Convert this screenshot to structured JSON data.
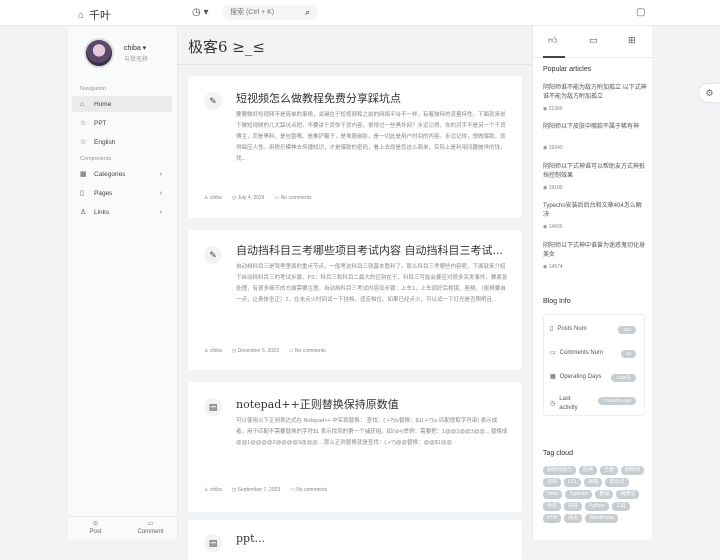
{
  "header": {
    "logo_text": "千叶",
    "search_placeholder": "搜索 (Ctrl + K)"
  },
  "sidebar": {
    "user_name": "chiba",
    "user_sub": "与世无枠",
    "nav_title": "Navigation",
    "components_title": "Components",
    "items": [
      {
        "label": "Home",
        "icon": "home-icon"
      },
      {
        "label": "PPT",
        "icon": "star-icon"
      },
      {
        "label": "English",
        "icon": "star-icon"
      }
    ],
    "components": [
      {
        "label": "Categories",
        "icon": "grid-icon"
      },
      {
        "label": "Pages",
        "icon": "file-icon"
      },
      {
        "label": "Links",
        "icon": "user-icon"
      }
    ],
    "footer": {
      "post": "Post",
      "comment": "Comment"
    }
  },
  "page_title": "极客6 ≥_≤",
  "posts": [
    {
      "icon": "edit-icon",
      "title": "短视频怎么做教程免费分享踩坑点",
      "excerpt": "要要做好短视频不是简单的事情，关键在于短视频和之前的网络平台不一样，有着独特的流量特性。下面就来说下做短视频的几大踩坑点把。不要讲于货你干货内容，很得过一些黑外网？永远记得，你的对手不是另一个干货博主，而是黑料，是包暨嘴、是推铲醒子，是堆股融影，是一切此是用户时间的内容。永远记得，想做爆款，就得睬应人性。用税乐模神去传播知识，才是爆款的密码，看上去原是您这么简单，实际上是利用冈趣施洋的钱，找...",
      "author": "chiba",
      "date": "July 4, 2024",
      "comments": "No comments"
    },
    {
      "icon": "edit-icon",
      "title": "自动挡科目三考哪些项目考试内容 自动挡科目三考试...",
      "excerpt": "自动挡科目三是驾考里面的重点节点，一般考这科目三就基本胜利了。那么科目三考哪些内容呢，下面就来介绍下自动挡科目三的考试步骤。PS：科目三和科目二最大的区别在于，科目三可能会要应对很多突发事件，要紧急处理，有很多细节的方面需要注意。自动挡科目三考试内容及步骤：上车1，上车调好后视镜、座椅。（座椅要自一点，让身体坐正）2，在未点火时间试一下挂档，适应档位。如果已经点火，可以试一下灯光是否照明且...",
      "author": "chiba",
      "date": "December 5, 2023",
      "comments": "No comments"
    },
    {
      "icon": "code-icon",
      "title": "notepad++正则替换保持原数值",
      "excerpt": "可以使用以下正则表达式在 Notepad++ 中实现替换： 查找：(.+?)\\s替换：$1(.+?)\\s 匹配提取字符串) 表示成者。用于匹配不需要替换的字符$1 表示找到的第一个捕获组。如(\\d+)举例：需要把：1@@2@@3@@... 替换成@@1@@@@2@@@@3@@@... 那么正则替换就是查找：(.+?)@@替换：@@$1@@",
      "author": "chiba",
      "date": "September 7, 2023",
      "comments": "No comments"
    },
    {
      "icon": "code-icon",
      "title": "ppt..."
    }
  ],
  "right": {
    "popular_title": "Popular articles",
    "popular": [
      {
        "title": "阴阳师谁不能为敌方附加孤立 以下式神谁不能为敌方附加孤立",
        "views": "21366"
      },
      {
        "title": "阴阳师以下皮肤中哪款不属于稀有神",
        "views": "19340"
      },
      {
        "title": "阴阳师以下式神谁可以帮助友方式神抵挡控制效果",
        "views": "19105"
      },
      {
        "title": "Typecho安装后后台和文章404怎么解决",
        "views": "14666"
      },
      {
        "title": "阴阳师以下式神中谁曾为迷惑鬼切化身美女",
        "views": "14574"
      }
    ],
    "blog_info_title": "Blog Info",
    "blog_info": [
      {
        "label": "Posts Num",
        "value": "320",
        "icon": "file-icon"
      },
      {
        "label": "Comments Num",
        "value": "10",
        "icon": "comment-icon"
      },
      {
        "label": "Operating Days",
        "value": "2200天",
        "icon": "calendar-icon"
      },
      {
        "label": "Last activity",
        "value": "7 Months Ago",
        "icon": "clock-icon"
      }
    ],
    "tag_title": "Tag cloud",
    "tags": [
      "阴阳师技巧",
      "原神",
      "王者",
      "阴阳师",
      "游戏",
      "LOL",
      "转载",
      "成长记",
      "Hello",
      "Typecho",
      "教程",
      "网络宝",
      "免费",
      "好好",
      "Python",
      "工具",
      "PHP",
      "网页",
      "WordPress"
    ]
  },
  "colors": {
    "accent": "#444444",
    "bg": "#f1f3f4"
  }
}
